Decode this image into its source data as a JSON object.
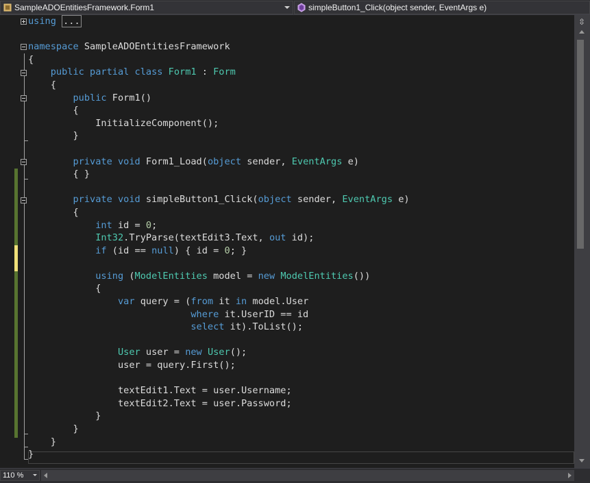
{
  "nav": {
    "type_dropdown": "SampleADOEntitiesFramework.Form1",
    "member_dropdown": "simpleButton1_Click(object sender, EventArgs e)"
  },
  "status": {
    "zoom": "110 %"
  },
  "code_lines": [
    [
      {
        "t": "using",
        "c": "kw"
      },
      {
        "t": " "
      },
      {
        "t": "...",
        "c": "collapsed"
      }
    ],
    [],
    [
      {
        "t": "namespace",
        "c": "kw"
      },
      {
        "t": " SampleADOEntitiesFramework"
      }
    ],
    [
      {
        "t": "{"
      }
    ],
    [
      {
        "t": "    "
      },
      {
        "t": "public",
        "c": "kw"
      },
      {
        "t": " "
      },
      {
        "t": "partial",
        "c": "kw"
      },
      {
        "t": " "
      },
      {
        "t": "class",
        "c": "kw"
      },
      {
        "t": " "
      },
      {
        "t": "Form1",
        "c": "ty"
      },
      {
        "t": " : "
      },
      {
        "t": "Form",
        "c": "ty"
      }
    ],
    [
      {
        "t": "    {"
      }
    ],
    [
      {
        "t": "        "
      },
      {
        "t": "public",
        "c": "kw"
      },
      {
        "t": " Form1()"
      }
    ],
    [
      {
        "t": "        {"
      }
    ],
    [
      {
        "t": "            InitializeComponent();"
      }
    ],
    [
      {
        "t": "        }"
      }
    ],
    [],
    [
      {
        "t": "        "
      },
      {
        "t": "private",
        "c": "kw"
      },
      {
        "t": " "
      },
      {
        "t": "void",
        "c": "kw"
      },
      {
        "t": " Form1_Load("
      },
      {
        "t": "object",
        "c": "kw"
      },
      {
        "t": " sender, "
      },
      {
        "t": "EventArgs",
        "c": "ty"
      },
      {
        "t": " e)"
      }
    ],
    [
      {
        "t": "        { }"
      }
    ],
    [],
    [
      {
        "t": "        "
      },
      {
        "t": "private",
        "c": "kw"
      },
      {
        "t": " "
      },
      {
        "t": "void",
        "c": "kw"
      },
      {
        "t": " simpleButton1_Click("
      },
      {
        "t": "object",
        "c": "kw"
      },
      {
        "t": " sender, "
      },
      {
        "t": "EventArgs",
        "c": "ty"
      },
      {
        "t": " e)"
      }
    ],
    [
      {
        "t": "        {"
      }
    ],
    [
      {
        "t": "            "
      },
      {
        "t": "int",
        "c": "kw"
      },
      {
        "t": " id = "
      },
      {
        "t": "0",
        "c": "nm"
      },
      {
        "t": ";"
      }
    ],
    [
      {
        "t": "            "
      },
      {
        "t": "Int32",
        "c": "ty"
      },
      {
        "t": ".TryParse(textEdit3.Text, "
      },
      {
        "t": "out",
        "c": "kw"
      },
      {
        "t": " id);"
      }
    ],
    [
      {
        "t": "            "
      },
      {
        "t": "if",
        "c": "kw"
      },
      {
        "t": " (id == "
      },
      {
        "t": "null",
        "c": "kw"
      },
      {
        "t": ") { id = "
      },
      {
        "t": "0",
        "c": "nm"
      },
      {
        "t": "; }"
      }
    ],
    [],
    [
      {
        "t": "            "
      },
      {
        "t": "using",
        "c": "kw"
      },
      {
        "t": " ("
      },
      {
        "t": "ModelEntities",
        "c": "ty"
      },
      {
        "t": " model = "
      },
      {
        "t": "new",
        "c": "kw"
      },
      {
        "t": " "
      },
      {
        "t": "ModelEntities",
        "c": "ty"
      },
      {
        "t": "())"
      }
    ],
    [
      {
        "t": "            {"
      }
    ],
    [
      {
        "t": "                "
      },
      {
        "t": "var",
        "c": "kw"
      },
      {
        "t": " query = ("
      },
      {
        "t": "from",
        "c": "kw"
      },
      {
        "t": " it "
      },
      {
        "t": "in",
        "c": "kw"
      },
      {
        "t": " model.User"
      }
    ],
    [
      {
        "t": "                             "
      },
      {
        "t": "where",
        "c": "kw"
      },
      {
        "t": " it.UserID == id"
      }
    ],
    [
      {
        "t": "                             "
      },
      {
        "t": "select",
        "c": "kw"
      },
      {
        "t": " it).ToList();"
      }
    ],
    [],
    [
      {
        "t": "                "
      },
      {
        "t": "User",
        "c": "ty"
      },
      {
        "t": " user = "
      },
      {
        "t": "new",
        "c": "kw"
      },
      {
        "t": " "
      },
      {
        "t": "User",
        "c": "ty"
      },
      {
        "t": "();"
      }
    ],
    [
      {
        "t": "                user = query.First();"
      }
    ],
    [],
    [
      {
        "t": "                textEdit1.Text = user.Username;"
      }
    ],
    [
      {
        "t": "                textEdit2.Text = user.Password;"
      }
    ],
    [
      {
        "t": "            }"
      }
    ],
    [
      {
        "t": "        }"
      }
    ],
    [
      {
        "t": "    }"
      }
    ],
    [
      {
        "t": "}"
      }
    ]
  ]
}
